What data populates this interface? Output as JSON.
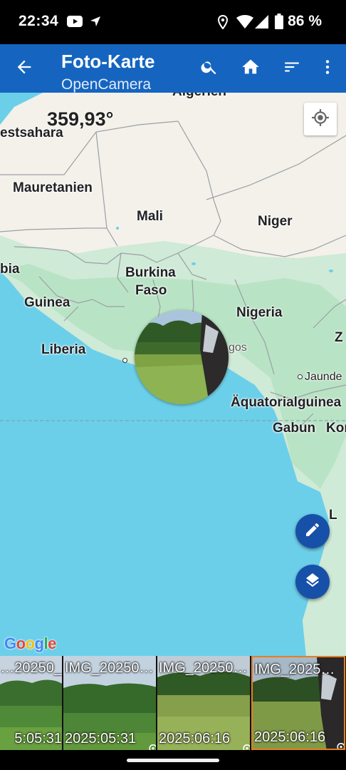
{
  "status_bar": {
    "time": "22:34",
    "battery": "86 %",
    "icons": [
      "youtube-icon",
      "navigation-arrow-icon",
      "location-pin-icon",
      "wifi-icon",
      "cell-signal-icon",
      "battery-icon"
    ]
  },
  "app_bar": {
    "title": "Foto-Karte",
    "subtitle": "OpenCamera",
    "actions": [
      "back-arrow-icon",
      "search-icon",
      "home-icon",
      "sort-icon",
      "more-vert-icon"
    ],
    "color": "#1565c0"
  },
  "map": {
    "compass": "359,93°",
    "labels": {
      "algerien": "Algerien",
      "westsahara": "estsahara",
      "mauretanien": "Mauretanien",
      "mali": "Mali",
      "niger": "Niger",
      "gambia": "bia",
      "burkina_1": "Burkina",
      "burkina_2": "Faso",
      "guinea": "Guinea",
      "nigeria": "Nigeria",
      "liberia": "Liberia",
      "lagos": "gos",
      "jaunde": "Jaunde",
      "aequatorialguinea": "Äquatorialguinea",
      "gabun": "Gabun",
      "kongo": "Kor",
      "z": "Z",
      "l": "L"
    },
    "water_color": "#6ccfe9",
    "land_color": "#f3f1ea",
    "vegetation_color": "#b9e3c5",
    "fab_color": "#1750a8",
    "attribution": "Google"
  },
  "thumbnails": [
    {
      "name": "_20250…",
      "date": "5:05:31"
    },
    {
      "name": "IMG_20250…",
      "date": "2025:05:31"
    },
    {
      "name": "IMG_20250…",
      "date": "2025:06:16"
    },
    {
      "name": "IMG_2025…",
      "date": "2025:06:16",
      "selected": true
    }
  ]
}
